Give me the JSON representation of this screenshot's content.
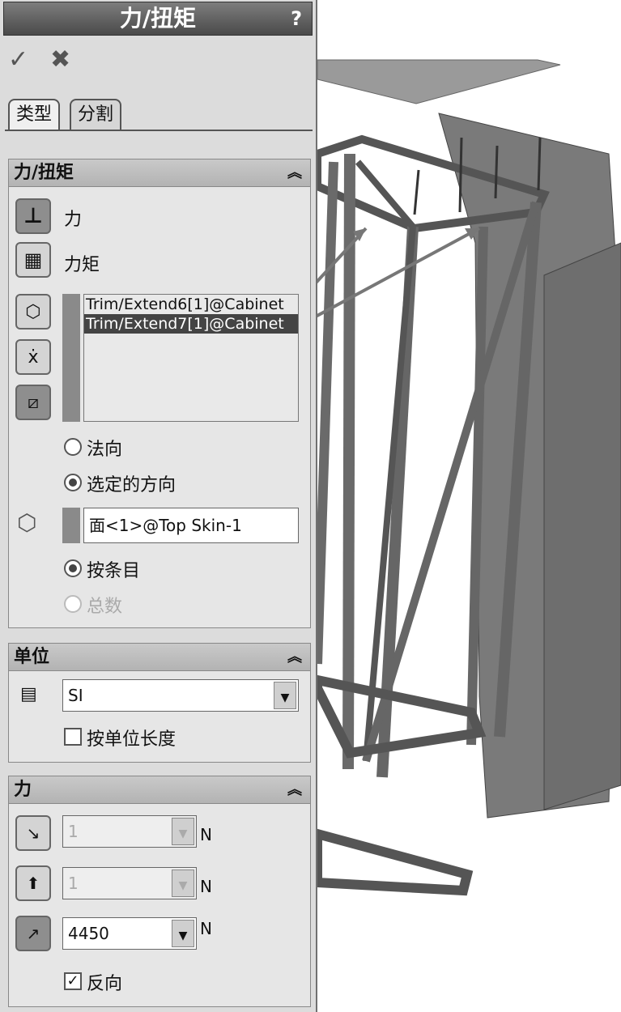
{
  "panel": {
    "title": "力/扭矩",
    "help": "?",
    "ok": "✓",
    "cancel": "✖",
    "tabs": [
      {
        "label": "类型"
      },
      {
        "label": "分割"
      }
    ]
  },
  "force_group": {
    "title": "力/扭矩",
    "collapse": "︽",
    "force_label": "力",
    "torque_label": "力矩",
    "entities": [
      "Trim/Extend6[1]@Cabinet",
      "Trim/Extend7[1]@Cabinet"
    ],
    "normal_label": "法向",
    "selected_dir_label": "选定的方向",
    "direction_ref": "面<1>@Top Skin-1",
    "per_item_label": "按条目",
    "total_label": "总数"
  },
  "unit_group": {
    "title": "单位",
    "collapse": "︽",
    "unit_value": "SI",
    "per_length_label": "按单位长度"
  },
  "force_values": {
    "title": "力",
    "collapse": "︽",
    "comp1": "1",
    "comp2": "1",
    "comp3": "4450",
    "unit": "N",
    "reverse_label": "反向",
    "reverse_checked": "✓"
  }
}
